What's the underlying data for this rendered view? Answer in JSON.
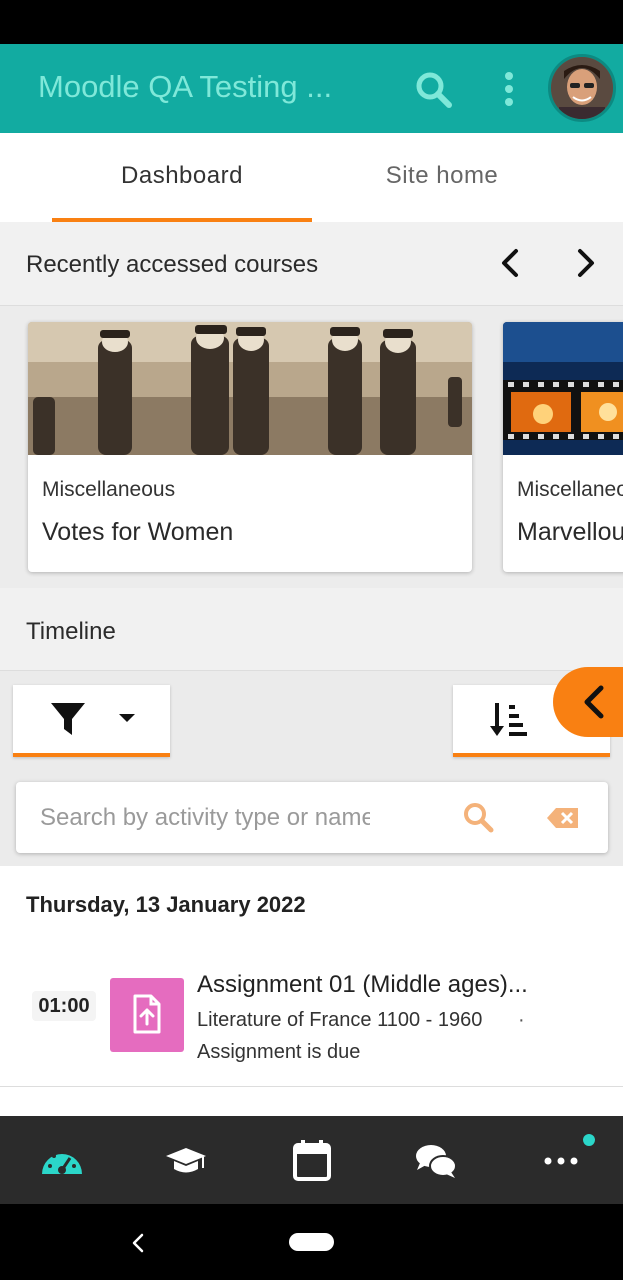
{
  "app_bar": {
    "title": "Moodle QA Testing ...",
    "icons": [
      "search-icon",
      "more-vertical-icon",
      "avatar"
    ]
  },
  "tabs": [
    {
      "label": "Dashboard",
      "selected": true
    },
    {
      "label": "Site home",
      "selected": false
    }
  ],
  "recent_courses": {
    "title": "Recently accessed courses",
    "courses": [
      {
        "category": "Miscellaneous",
        "name": "Votes for Women"
      },
      {
        "category": "Miscellaneous",
        "name": "Marvellous"
      }
    ]
  },
  "timeline": {
    "title": "Timeline",
    "search_placeholder": "Search by activity type or name",
    "date": "Thursday, 13 January 2022",
    "events": [
      {
        "time": "01:00",
        "title": "Assignment 01 (Middle ages)...",
        "course": "Literature of France 1100 - 1960",
        "separator": "·",
        "description": "Assignment is due",
        "icon": "assignment-icon"
      }
    ]
  },
  "bottom_nav": {
    "items": [
      "dashboard-icon",
      "courses-icon",
      "calendar-icon",
      "messages-icon",
      "more-icon"
    ],
    "notification": true
  },
  "colors": {
    "primary": "#12aba1",
    "accent": "#f98012",
    "assignment": "#e56cbf",
    "nav_background": "#2b2b2b"
  }
}
